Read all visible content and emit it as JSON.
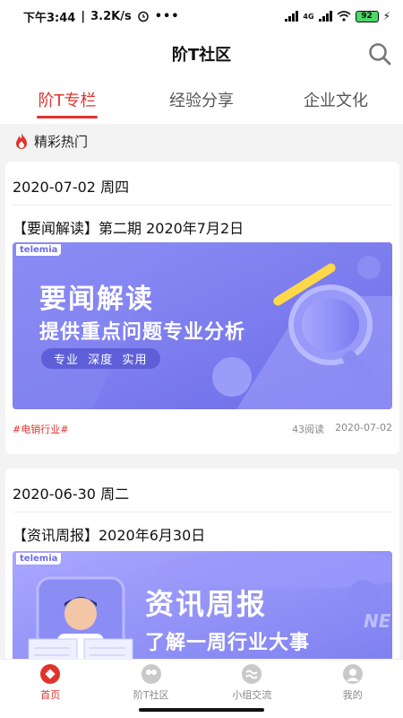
{
  "status_bar": {
    "time": "下午3:44",
    "speed": "3.2K/s",
    "battery": "92",
    "network": "4G"
  },
  "header": {
    "title": "阶T社区"
  },
  "tabs": [
    {
      "label": "阶T专栏",
      "active": true
    },
    {
      "label": "经验分享",
      "active": false
    },
    {
      "label": "企业文化",
      "active": false
    }
  ],
  "section": {
    "title": "精彩热门"
  },
  "articles": [
    {
      "date": "2020-07-02  周四",
      "headline": "【要闻解读】第二期 2020年7月2日",
      "banner": {
        "brand": "telemia",
        "main": "要闻解读",
        "sub": "提供重点问题专业分析",
        "chips": "专业  深度  实用"
      },
      "tag": "#电销行业#",
      "reads": "43阅读",
      "publish_date": "2020-07-02"
    },
    {
      "date": "2020-06-30  周二",
      "headline": "【资讯周报】2020年6月30日",
      "banner": {
        "brand": "telemia",
        "main": "资讯周报",
        "sub": "了解一周行业大事",
        "watermark": "NEW"
      }
    }
  ],
  "bottom_nav": [
    {
      "label": "首页",
      "icon": "home-icon",
      "active": true
    },
    {
      "label": "阶T社区",
      "icon": "community-icon",
      "active": false
    },
    {
      "label": "小组交流",
      "icon": "group-chat-icon",
      "active": false
    },
    {
      "label": "我的",
      "icon": "profile-icon",
      "active": false
    }
  ],
  "colors": {
    "accent": "#e0332d",
    "banner_purple": "#7a7cf0"
  }
}
